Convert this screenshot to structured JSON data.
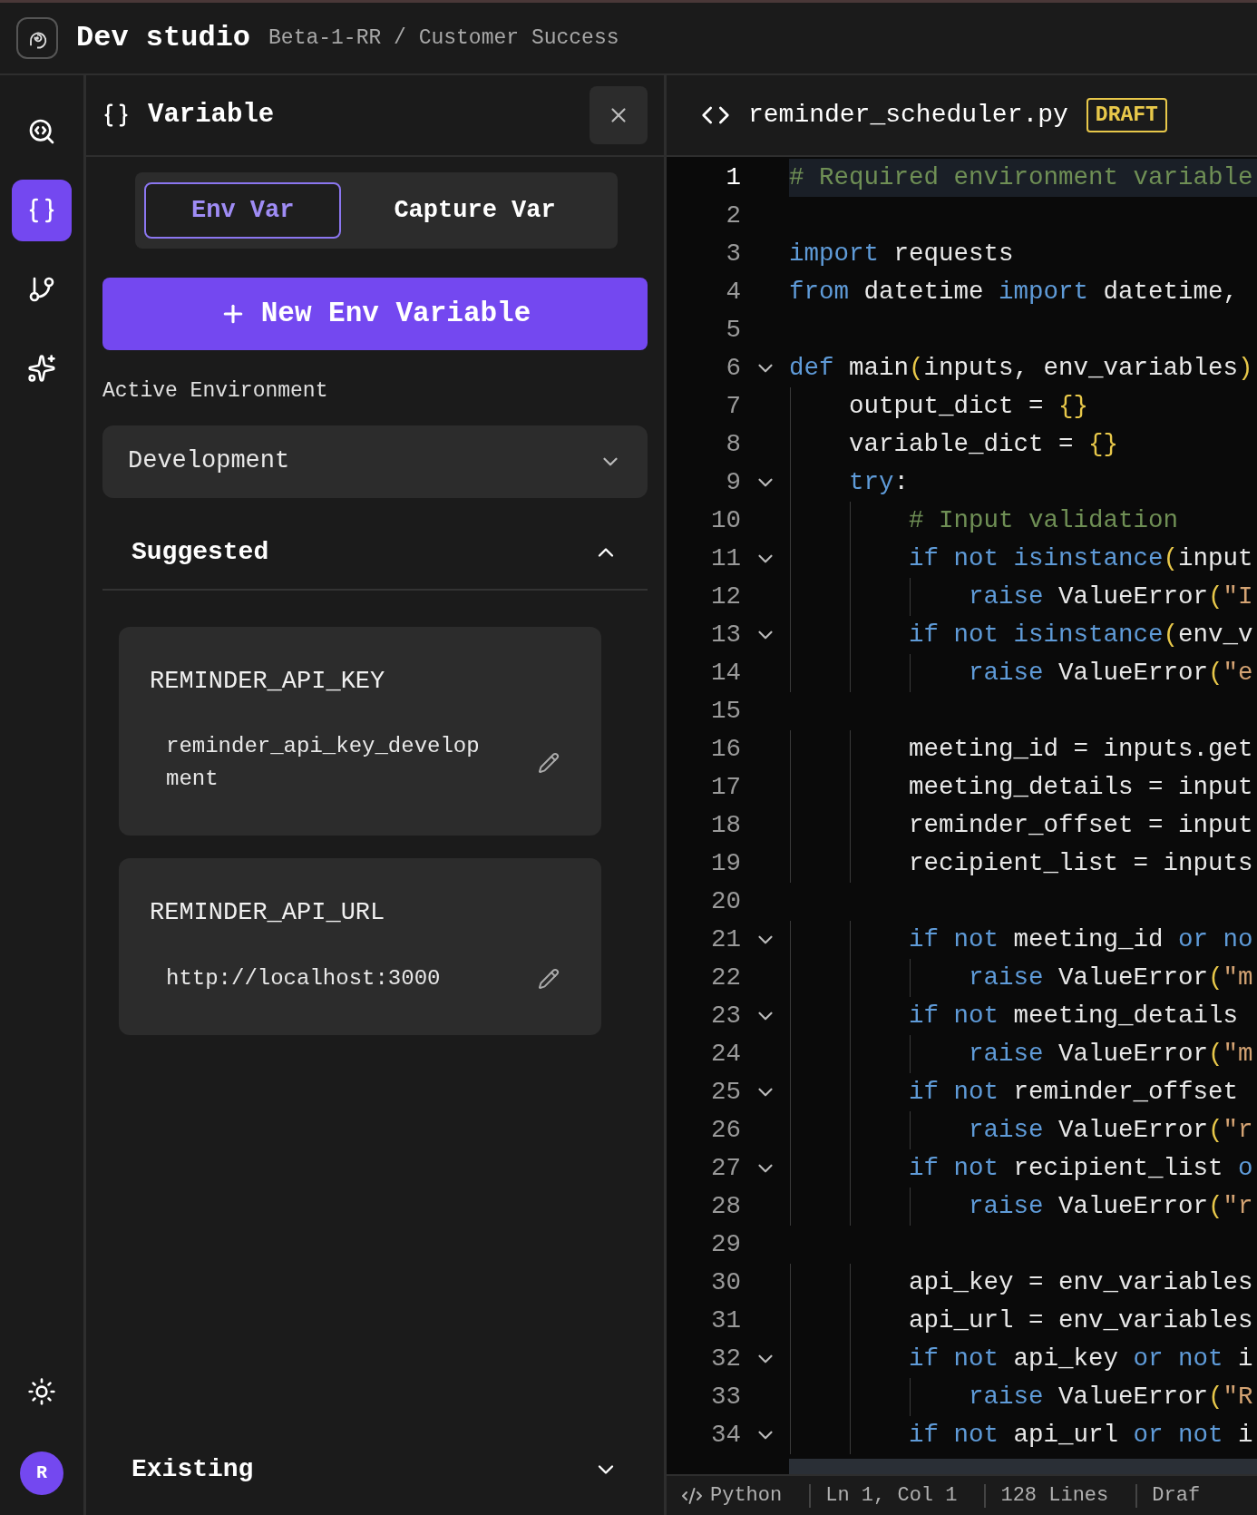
{
  "app": {
    "title": "Dev studio",
    "breadcrumb": "Beta-1-RR / Customer Success"
  },
  "rail": [
    {
      "kind": "search-code",
      "selected": false
    },
    {
      "kind": "braces",
      "selected": true
    },
    {
      "kind": "branch",
      "selected": false
    },
    {
      "kind": "sparkles",
      "selected": false
    }
  ],
  "user": {
    "initial": "R"
  },
  "panel": {
    "title": "Variable",
    "tabs": [
      {
        "label": "Env Var",
        "selected": true
      },
      {
        "label": "Capture Var",
        "selected": false
      }
    ],
    "new_button": "New Env Variable",
    "environment": {
      "label": "Active Environment",
      "value": "Development"
    },
    "sections": [
      {
        "title": "Suggested",
        "expanded": true,
        "variables": [
          {
            "name": "REMINDER_API_KEY",
            "value": "reminder_api_key_development"
          },
          {
            "name": "REMINDER_API_URL",
            "value": "http://localhost:3000"
          }
        ]
      },
      {
        "title": "Existing",
        "expanded": false
      }
    ]
  },
  "editor": {
    "filename": "reminder_scheduler.py",
    "badge": "DRAFT",
    "lines": [
      {
        "number": "1",
        "current": true,
        "fold": false,
        "tokens": [
          {
            "t": "# Required environment variable",
            "kind": "comment"
          }
        ]
      },
      {
        "number": "2",
        "current": false,
        "fold": false
      },
      {
        "number": "3",
        "current": false,
        "fold": false,
        "tokens": [
          {
            "t": "import",
            "kind": "keyword"
          },
          {
            "t": " requests",
            "kind": "name"
          }
        ]
      },
      {
        "number": "4",
        "current": false,
        "fold": false,
        "tokens": [
          {
            "t": "from",
            "kind": "keyword"
          },
          {
            "t": " datetime ",
            "kind": "name"
          },
          {
            "t": "import",
            "kind": "keyword"
          },
          {
            "t": " datetime,",
            "kind": "name"
          }
        ]
      },
      {
        "number": "5",
        "current": false,
        "fold": false
      },
      {
        "number": "6",
        "current": false,
        "fold": true,
        "tokens": [
          {
            "t": "def",
            "kind": "keyword"
          },
          {
            "t": " main",
            "kind": "name"
          },
          {
            "t": "(",
            "kind": "bracket"
          },
          {
            "t": "inputs, env_variables",
            "kind": "name"
          },
          {
            "t": ")",
            "kind": "bracket"
          }
        ]
      },
      {
        "number": "7",
        "current": false,
        "fold": false,
        "tokens": [
          {
            "t": "    output_dict = ",
            "kind": "name"
          },
          {
            "t": "{}",
            "kind": "bracket"
          }
        ]
      },
      {
        "number": "8",
        "current": false,
        "fold": false,
        "tokens": [
          {
            "t": "    variable_dict = ",
            "kind": "name"
          },
          {
            "t": "{}",
            "kind": "bracket"
          }
        ]
      },
      {
        "number": "9",
        "current": false,
        "fold": true,
        "tokens": [
          {
            "t": "    try",
            "kind": "keyword"
          },
          {
            "t": ":",
            "kind": "name"
          }
        ]
      },
      {
        "number": "10",
        "current": false,
        "fold": false,
        "tokens": [
          {
            "t": "        # Input validation",
            "kind": "comment"
          }
        ]
      },
      {
        "number": "11",
        "current": false,
        "fold": true,
        "tokens": [
          {
            "t": "        if not",
            "kind": "keyword"
          },
          {
            "t": " isinstance",
            "kind": "keyword"
          },
          {
            "t": "(",
            "kind": "bracket"
          },
          {
            "t": "input",
            "kind": "name"
          }
        ]
      },
      {
        "number": "12",
        "current": false,
        "fold": false,
        "tokens": [
          {
            "t": "            raise",
            "kind": "keyword"
          },
          {
            "t": " ValueError",
            "kind": "name"
          },
          {
            "t": "(",
            "kind": "bracket"
          },
          {
            "t": "\"I",
            "kind": "string"
          }
        ]
      },
      {
        "number": "13",
        "current": false,
        "fold": true,
        "tokens": [
          {
            "t": "        if not",
            "kind": "keyword"
          },
          {
            "t": " isinstance",
            "kind": "keyword"
          },
          {
            "t": "(",
            "kind": "bracket"
          },
          {
            "t": "env_v",
            "kind": "name"
          }
        ]
      },
      {
        "number": "14",
        "current": false,
        "fold": false,
        "tokens": [
          {
            "t": "            raise",
            "kind": "keyword"
          },
          {
            "t": " ValueError",
            "kind": "name"
          },
          {
            "t": "(",
            "kind": "bracket"
          },
          {
            "t": "\"e",
            "kind": "string"
          }
        ]
      },
      {
        "number": "15",
        "current": false,
        "fold": false
      },
      {
        "number": "16",
        "current": false,
        "fold": false,
        "tokens": [
          {
            "t": "        meeting_id = inputs.get",
            "kind": "name"
          }
        ]
      },
      {
        "number": "17",
        "current": false,
        "fold": false,
        "tokens": [
          {
            "t": "        meeting_details = input",
            "kind": "name"
          }
        ]
      },
      {
        "number": "18",
        "current": false,
        "fold": false,
        "tokens": [
          {
            "t": "        reminder_offset = input",
            "kind": "name"
          }
        ]
      },
      {
        "number": "19",
        "current": false,
        "fold": false,
        "tokens": [
          {
            "t": "        recipient_list = inputs",
            "kind": "name"
          }
        ]
      },
      {
        "number": "20",
        "current": false,
        "fold": false
      },
      {
        "number": "21",
        "current": false,
        "fold": true,
        "tokens": [
          {
            "t": "        if not",
            "kind": "keyword"
          },
          {
            "t": " meeting_id ",
            "kind": "name"
          },
          {
            "t": "or no",
            "kind": "keyword"
          }
        ]
      },
      {
        "number": "22",
        "current": false,
        "fold": false,
        "tokens": [
          {
            "t": "            raise",
            "kind": "keyword"
          },
          {
            "t": " ValueError",
            "kind": "name"
          },
          {
            "t": "(",
            "kind": "bracket"
          },
          {
            "t": "\"m",
            "kind": "string"
          }
        ]
      },
      {
        "number": "23",
        "current": false,
        "fold": true,
        "tokens": [
          {
            "t": "        if not",
            "kind": "keyword"
          },
          {
            "t": " meeting_details",
            "kind": "name"
          }
        ]
      },
      {
        "number": "24",
        "current": false,
        "fold": false,
        "tokens": [
          {
            "t": "            raise",
            "kind": "keyword"
          },
          {
            "t": " ValueError",
            "kind": "name"
          },
          {
            "t": "(",
            "kind": "bracket"
          },
          {
            "t": "\"m",
            "kind": "string"
          }
        ]
      },
      {
        "number": "25",
        "current": false,
        "fold": true,
        "tokens": [
          {
            "t": "        if not",
            "kind": "keyword"
          },
          {
            "t": " reminder_offset",
            "kind": "name"
          }
        ]
      },
      {
        "number": "26",
        "current": false,
        "fold": false,
        "tokens": [
          {
            "t": "            raise",
            "kind": "keyword"
          },
          {
            "t": " ValueError",
            "kind": "name"
          },
          {
            "t": "(",
            "kind": "bracket"
          },
          {
            "t": "\"r",
            "kind": "string"
          }
        ]
      },
      {
        "number": "27",
        "current": false,
        "fold": true,
        "tokens": [
          {
            "t": "        if not",
            "kind": "keyword"
          },
          {
            "t": " recipient_list ",
            "kind": "name"
          },
          {
            "t": "o",
            "kind": "keyword"
          }
        ]
      },
      {
        "number": "28",
        "current": false,
        "fold": false,
        "tokens": [
          {
            "t": "            raise",
            "kind": "keyword"
          },
          {
            "t": " ValueError",
            "kind": "name"
          },
          {
            "t": "(",
            "kind": "bracket"
          },
          {
            "t": "\"r",
            "kind": "string"
          }
        ]
      },
      {
        "number": "29",
        "current": false,
        "fold": false
      },
      {
        "number": "30",
        "current": false,
        "fold": false,
        "tokens": [
          {
            "t": "        api_key = env_variables",
            "kind": "name"
          }
        ]
      },
      {
        "number": "31",
        "current": false,
        "fold": false,
        "tokens": [
          {
            "t": "        api_url = env_variables",
            "kind": "name"
          }
        ]
      },
      {
        "number": "32",
        "current": false,
        "fold": true,
        "tokens": [
          {
            "t": "        if not",
            "kind": "keyword"
          },
          {
            "t": " api_key ",
            "kind": "name"
          },
          {
            "t": "or not",
            "kind": "keyword"
          },
          {
            "t": " i",
            "kind": "name"
          }
        ]
      },
      {
        "number": "33",
        "current": false,
        "fold": false,
        "tokens": [
          {
            "t": "            raise",
            "kind": "keyword"
          },
          {
            "t": " ValueError",
            "kind": "name"
          },
          {
            "t": "(",
            "kind": "bracket"
          },
          {
            "t": "\"R",
            "kind": "string"
          }
        ]
      },
      {
        "number": "34",
        "current": false,
        "fold": true,
        "tokens": [
          {
            "t": "        if not",
            "kind": "keyword"
          },
          {
            "t": " api_url ",
            "kind": "name"
          },
          {
            "t": "or not",
            "kind": "keyword"
          },
          {
            "t": " i",
            "kind": "name"
          }
        ]
      }
    ],
    "status": [
      "Python",
      "Ln 1, Col 1",
      "128 Lines",
      "Draf"
    ]
  }
}
